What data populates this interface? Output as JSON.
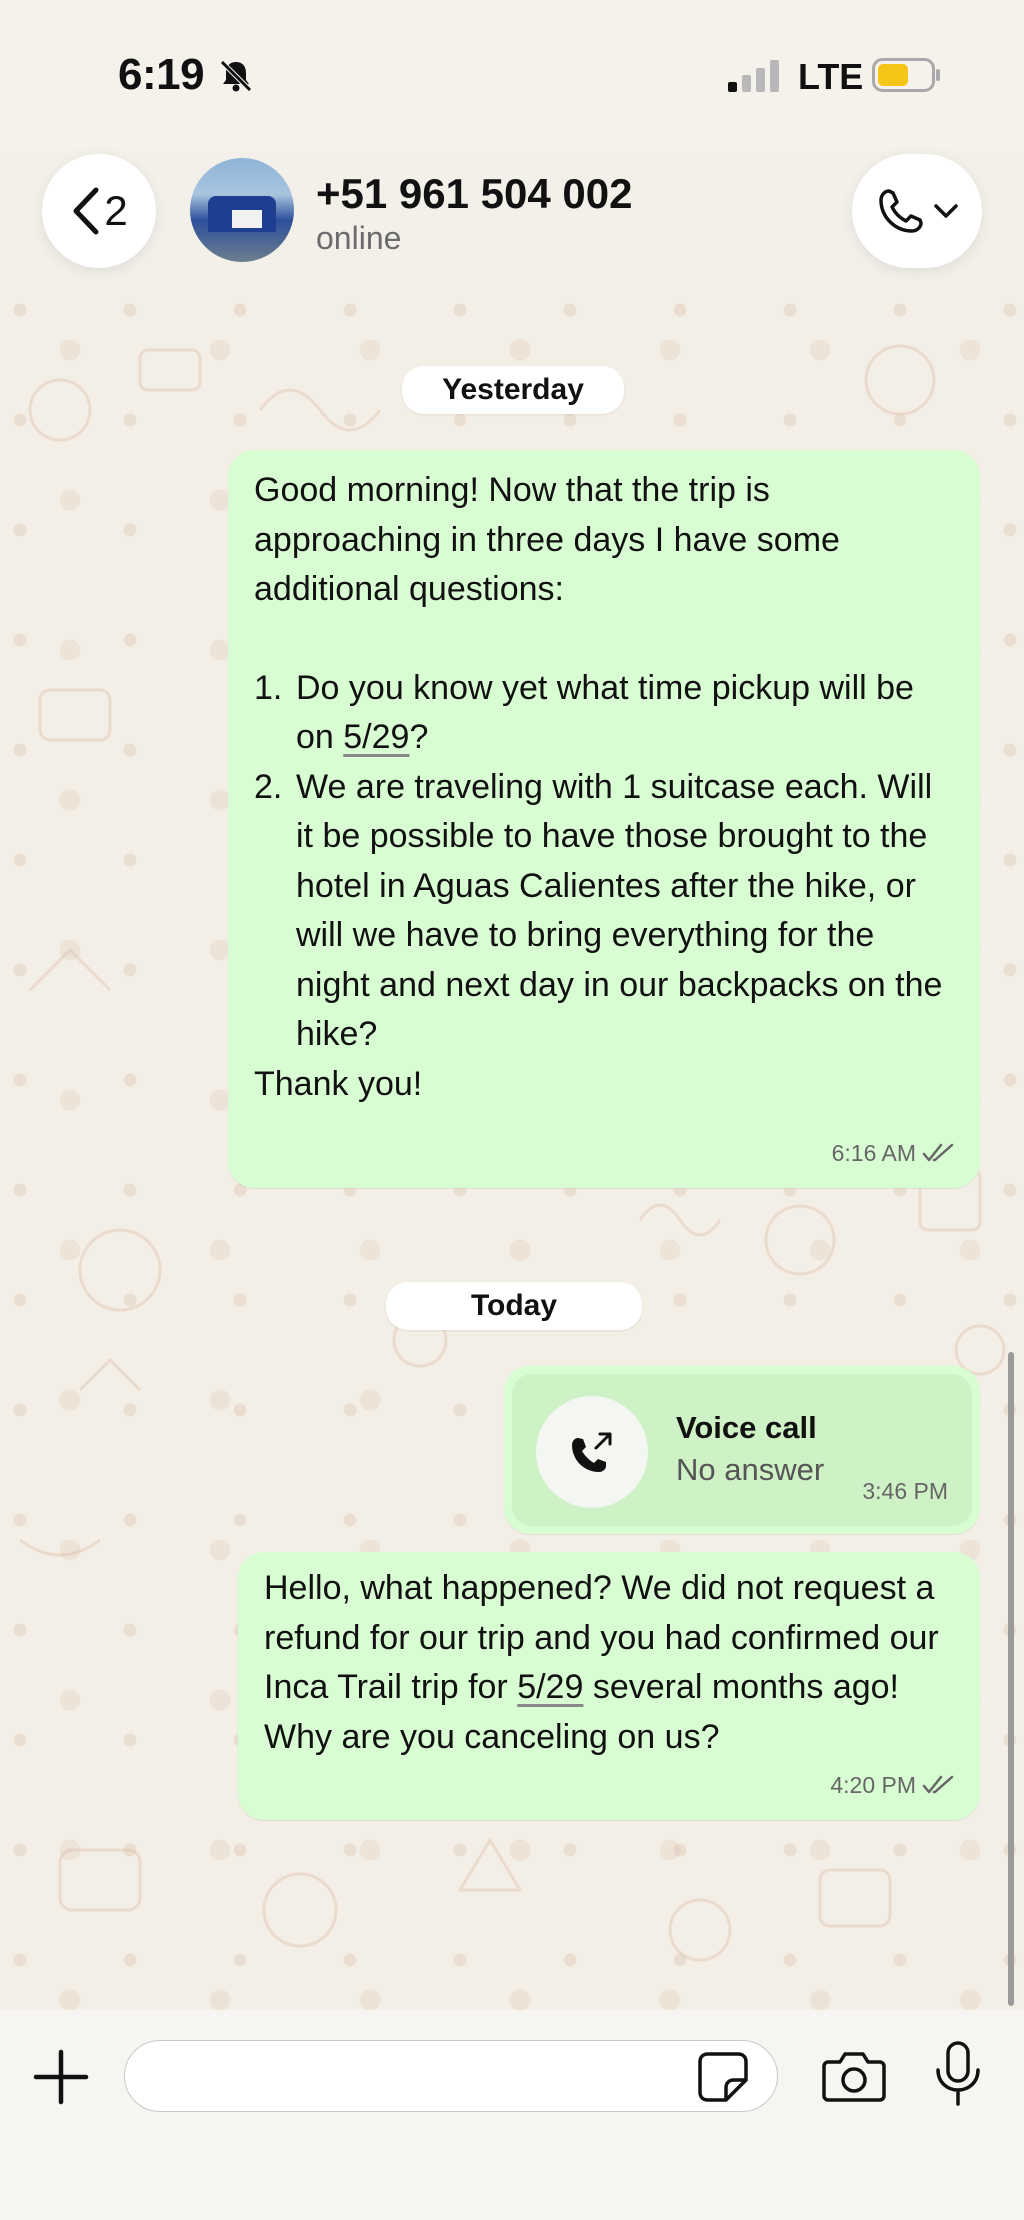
{
  "status_bar": {
    "time": "6:19",
    "network": "LTE",
    "battery_color": "#f5c518",
    "icons": [
      "bell-slash-icon",
      "signal-icon",
      "battery-icon"
    ]
  },
  "header": {
    "back_count": "2",
    "contact_name": "+51 961 504 002",
    "contact_status": "online",
    "icons": [
      "chevron-left-icon",
      "phone-icon",
      "chevron-down-icon"
    ]
  },
  "chat": {
    "date_yesterday": "Yesterday",
    "date_today": "Today",
    "message1": {
      "intro": "Good morning! Now that the trip is approaching in three days I have some additional questions:",
      "items": [
        {
          "num": "1.",
          "before": "Do you know yet what time pickup will be on ",
          "link": "5/29",
          "after": "?"
        },
        {
          "num": "2.",
          "text": "We are traveling with 1 suitcase each. Will it be possible to have those brought to the hotel in Aguas Calientes after the hike, or will we have to bring everything for the night and next day in our backpacks on the hike?"
        }
      ],
      "closing": "Thank you!",
      "time": "6:16 AM",
      "status": "read"
    },
    "voice_call": {
      "title": "Voice call",
      "subtitle": "No answer",
      "time": "3:46 PM"
    },
    "message2": {
      "before": "Hello, what happened? We did not request a refund for our trip and you had confirmed our Inca Trail trip for ",
      "link": "5/29",
      "after": " several months ago! Why are you canceling on us?",
      "time": "4:20 PM",
      "status": "read"
    }
  },
  "input_bar": {
    "message_value": "",
    "icons": [
      "plus-icon",
      "sticker-icon",
      "camera-icon",
      "microphone-icon"
    ]
  },
  "colors": {
    "outgoing_bubble": "#d9fdd3",
    "chat_background": "#f4efe6",
    "read_ticks": "#666666"
  }
}
